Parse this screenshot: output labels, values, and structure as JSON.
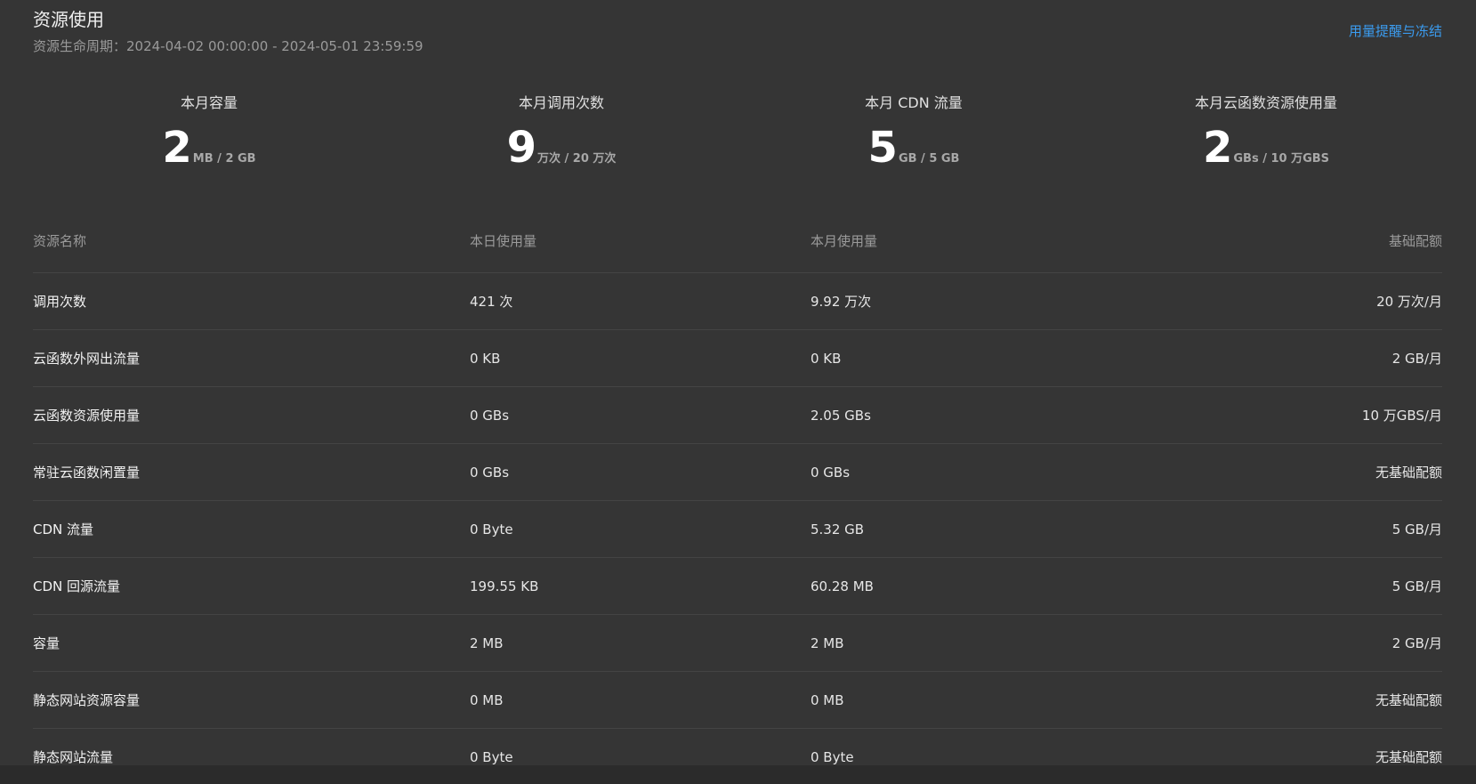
{
  "header": {
    "title": "资源使用",
    "lifecycle": "资源生命周期：2024-04-02 00:00:00 - 2024-05-01 23:59:59",
    "alert_link": "用量提醒与冻结"
  },
  "stats": [
    {
      "label": "本月容量",
      "value": "2",
      "unit": "MB / 2 GB"
    },
    {
      "label": "本月调用次数",
      "value": "9",
      "unit": "万次 / 20 万次"
    },
    {
      "label": "本月 CDN 流量",
      "value": "5",
      "unit": "GB / 5 GB"
    },
    {
      "label": "本月云函数资源使用量",
      "value": "2",
      "unit": "GBs / 10 万GBS"
    }
  ],
  "table": {
    "columns": [
      "资源名称",
      "本日使用量",
      "本月使用量",
      "基础配额"
    ],
    "rows": [
      [
        "调用次数",
        "421 次",
        "9.92 万次",
        "20 万次/月"
      ],
      [
        "云函数外网出流量",
        "0 KB",
        "0 KB",
        "2 GB/月"
      ],
      [
        "云函数资源使用量",
        "0 GBs",
        "2.05 GBs",
        "10 万GBS/月"
      ],
      [
        "常驻云函数闲置量",
        "0 GBs",
        "0 GBs",
        "无基础配额"
      ],
      [
        "CDN 流量",
        "0 Byte",
        "5.32 GB",
        "5 GB/月"
      ],
      [
        "CDN 回源流量",
        "199.55 KB",
        "60.28 MB",
        "5 GB/月"
      ],
      [
        "容量",
        "2 MB",
        "2 MB",
        "2 GB/月"
      ],
      [
        "静态网站资源容量",
        "0 MB",
        "0 MB",
        "无基础配额"
      ],
      [
        "静态网站流量",
        "0 Byte",
        "0 Byte",
        "无基础配额"
      ]
    ]
  },
  "colors": {
    "background": "#353535",
    "link": "#3b9cf0",
    "divider": "#444444"
  }
}
